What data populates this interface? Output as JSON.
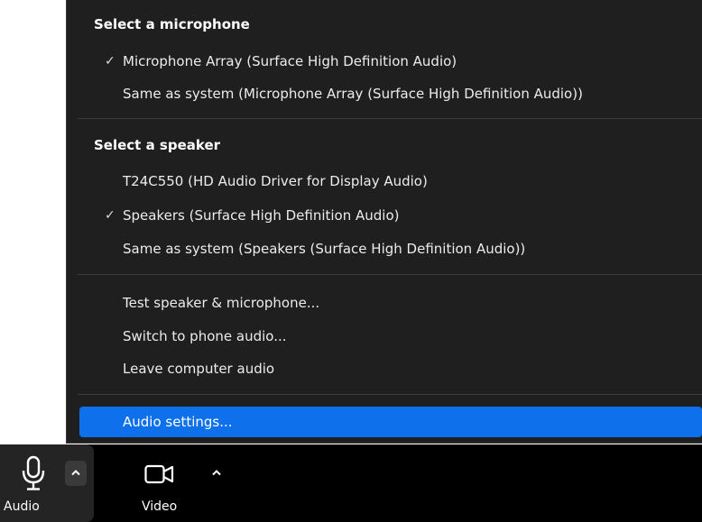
{
  "menu": {
    "microphone_section_title": "Select a microphone",
    "microphones": [
      {
        "label": "Microphone Array (Surface High Definition Audio)",
        "checked": true
      },
      {
        "label": "Same as system (Microphone Array (Surface High Definition Audio))",
        "checked": false
      }
    ],
    "speaker_section_title": "Select a speaker",
    "speakers": [
      {
        "label": "T24C550 (HD Audio Driver for Display Audio)",
        "checked": false
      },
      {
        "label": "Speakers (Surface High Definition Audio)",
        "checked": true
      },
      {
        "label": "Same as system (Speakers (Surface High Definition Audio))",
        "checked": false
      }
    ],
    "actions": [
      "Test speaker & microphone...",
      "Switch to phone audio...",
      "Leave computer audio"
    ],
    "settings_label": "Audio settings...",
    "check_glyph": "✓"
  },
  "toolbar": {
    "audio_label": "Audio",
    "video_label": "Video",
    "audio_icon": "microphone-icon",
    "video_icon": "video-camera-icon",
    "caret_icon": "chevron-up-icon"
  },
  "colors": {
    "menu_bg": "#1f1f1f",
    "highlight": "#0e71eb",
    "toolbar_bg": "#000000"
  }
}
